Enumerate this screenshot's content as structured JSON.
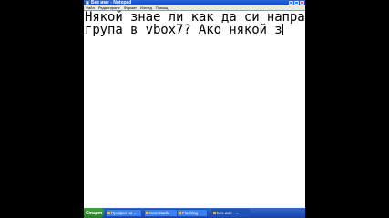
{
  "window": {
    "title": "Без име - Notepad",
    "controls": [
      "minimize-icon",
      "maximize-icon",
      "close-icon"
    ]
  },
  "menu": {
    "items": [
      "Файл",
      "Редактиране",
      "Формат",
      "Изглед",
      "Помощ"
    ]
  },
  "editor": {
    "lines": [
      "Някой знае ли как да си направя",
      "група в vbox7? Ако някой з"
    ]
  },
  "taskbar": {
    "start_label": "Старт",
    "tasks": [
      {
        "label": "Профил на ...",
        "icon": "browser-icon"
      },
      {
        "label": "CamStudio",
        "icon": "camstudio-icon"
      },
      {
        "label": "Flashing",
        "icon": "flash-icon"
      },
      {
        "label": "Без име - ...",
        "icon": "notepad-icon"
      }
    ]
  },
  "colors": {
    "titlebar": "#0f48c7",
    "menubar": "#ece9d8",
    "taskbar": "#1941a5",
    "start": "#2b7d2b",
    "background": "#000000"
  }
}
